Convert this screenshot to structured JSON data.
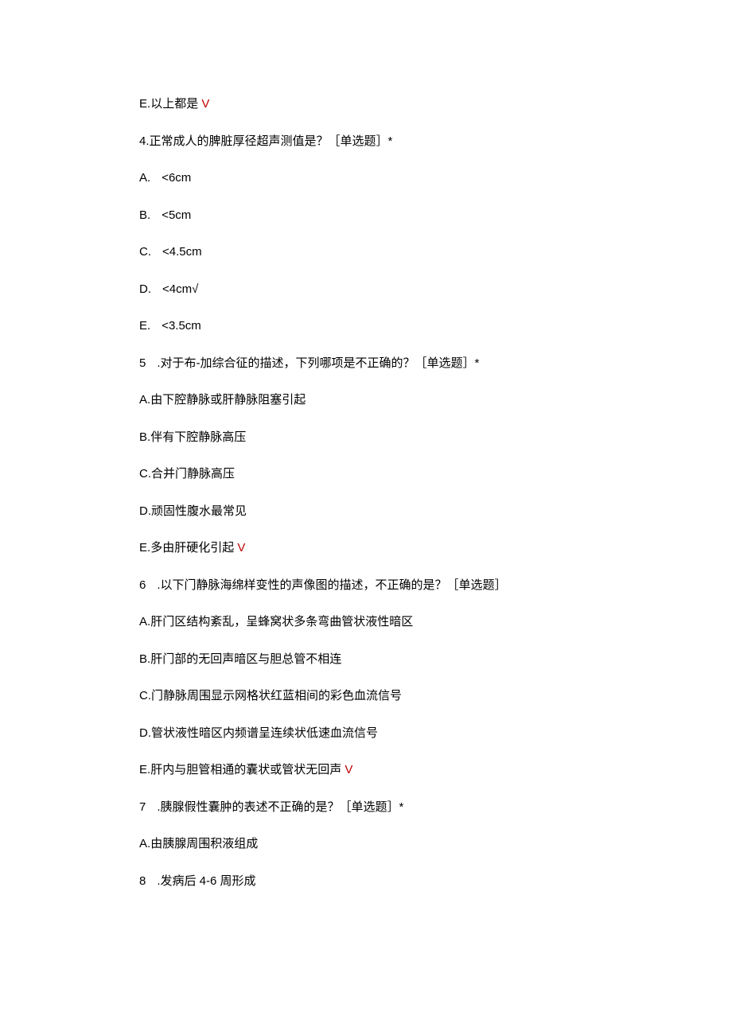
{
  "q3": {
    "optionE": {
      "prefix": "E.",
      "text": "以上都是",
      "mark": " V"
    }
  },
  "q4": {
    "stem": {
      "prefix": "4.",
      "text": "正常成人的脾脏厚径超声测值是？［单选题］*"
    },
    "optionA": {
      "prefix": "A.",
      "text": "<6cm"
    },
    "optionB": {
      "prefix": "B.",
      "text": "<5cm"
    },
    "optionC": {
      "prefix": "C.",
      "text": "<4.5cm"
    },
    "optionD": {
      "prefix": "D.",
      "text": "<4cm",
      "mark": "√"
    },
    "optionE": {
      "prefix": "E.",
      "text": "<3.5cm"
    }
  },
  "q5": {
    "stem": {
      "prefix": "5",
      "text": ".对于布-加综合征的描述，下列哪项是不正确的？［单选题］*"
    },
    "optionA": {
      "prefix": "A.",
      "text": "由下腔静脉或肝静脉阻塞引起"
    },
    "optionB": {
      "prefix": "B.",
      "text": "伴有下腔静脉高压"
    },
    "optionC": {
      "prefix": "C.",
      "text": "合并门静脉高压"
    },
    "optionD": {
      "prefix": "D.",
      "text": "顽固性腹水最常见"
    },
    "optionE": {
      "prefix": "E.",
      "text": "多由肝硬化引起",
      "mark": " V"
    }
  },
  "q6": {
    "stem": {
      "prefix": "6",
      "text": ".以下门静脉海绵样变性的声像图的描述，不正确的是？［单选题］"
    },
    "optionA": {
      "prefix": "A.",
      "text": "肝门区结构紊乱，呈蜂窝状多条弯曲管状液性暗区"
    },
    "optionB": {
      "prefix": "B.",
      "text": "肝门部的无回声暗区与胆总管不相连"
    },
    "optionC": {
      "prefix": "C.",
      "text": "门静脉周围显示网格状红蓝相间的彩色血流信号"
    },
    "optionD": {
      "prefix": "D.",
      "text": "管状液性暗区内频谱呈连续状低速血流信号"
    },
    "optionE": {
      "prefix": "E.",
      "text": "肝内与胆管相通的囊状或管状无回声",
      "mark": " V"
    }
  },
  "q7": {
    "stem": {
      "prefix": "7",
      "text": ".胰腺假性囊肿的表述不正确的是？［单选题］*"
    },
    "optionA": {
      "prefix": "A.",
      "text": "由胰腺周围积液组成"
    }
  },
  "q8": {
    "stem": {
      "prefix": "8",
      "text": ".发病后 4-6 周形成"
    }
  }
}
